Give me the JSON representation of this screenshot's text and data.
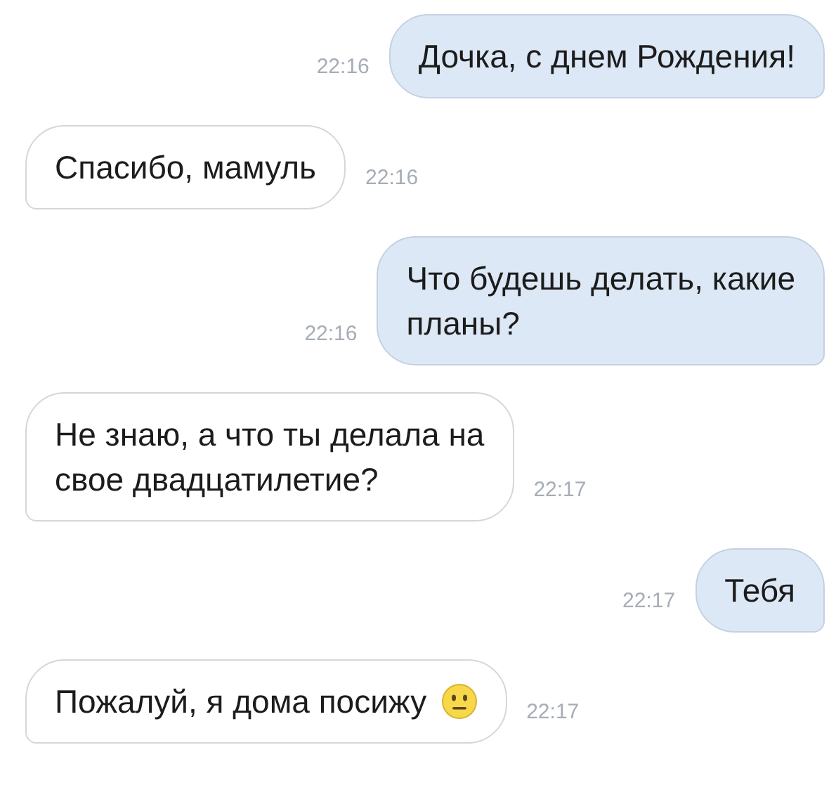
{
  "messages": [
    {
      "kind": "outgoing",
      "text": "Дочка, с днем Рождения!",
      "time": "22:16",
      "has_emoji": false
    },
    {
      "kind": "incoming",
      "text": "Спасибо, мамуль",
      "time": "22:16",
      "has_emoji": false
    },
    {
      "kind": "outgoing",
      "text": "Что будешь делать, какие\nпланы?",
      "time": "22:16",
      "has_emoji": false
    },
    {
      "kind": "incoming",
      "text": "Не знаю, а что ты делала на\nсвое двадцатилетие?",
      "time": "22:17",
      "has_emoji": false
    },
    {
      "kind": "outgoing",
      "text": "Тебя",
      "time": "22:17",
      "has_emoji": false
    },
    {
      "kind": "incoming",
      "text": "Пожалуй, я дома посижу",
      "time": "22:17",
      "has_emoji": true
    }
  ]
}
